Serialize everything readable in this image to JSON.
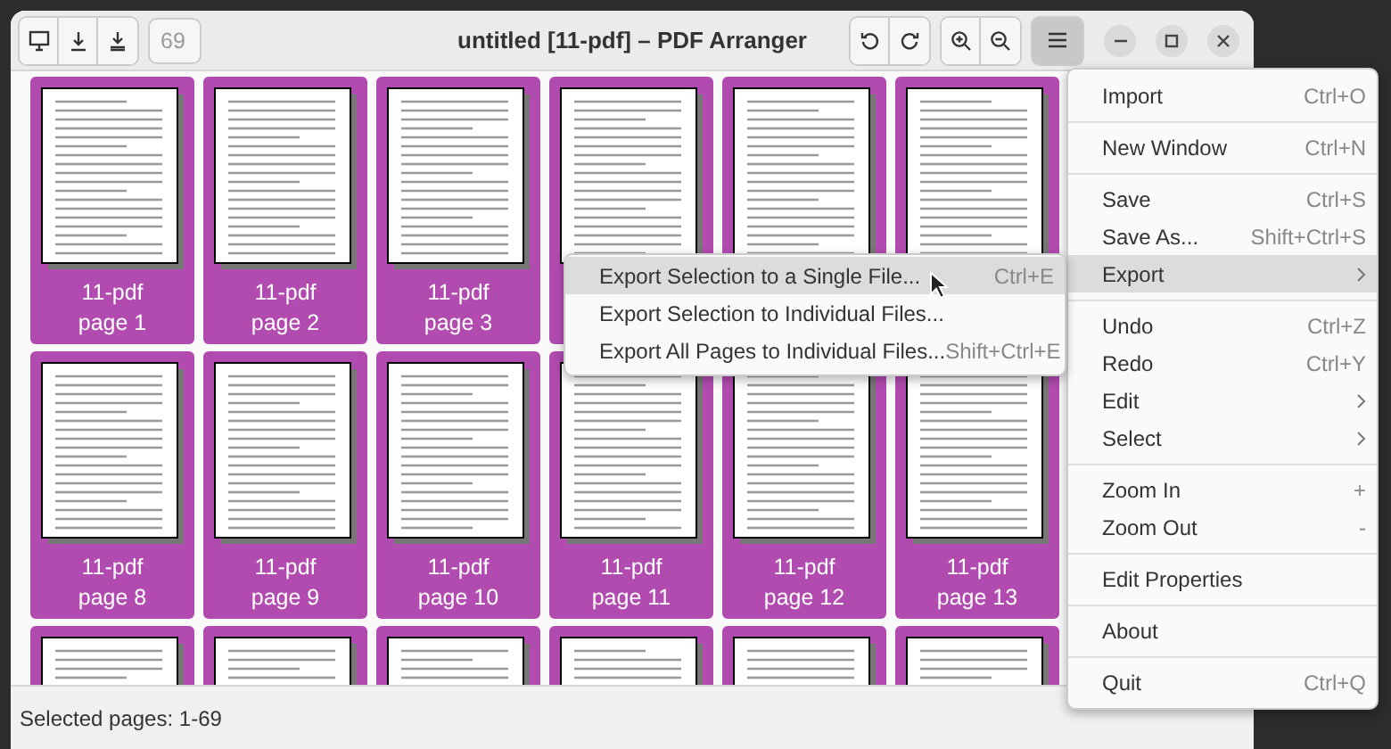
{
  "window": {
    "title": "untitled [11-pdf] – PDF Arranger"
  },
  "page_field": {
    "value": "69"
  },
  "menu_button": {
    "pressed": true
  },
  "pages": [
    {
      "file": "11-pdf",
      "page": "page 1",
      "selected": true
    },
    {
      "file": "11-pdf",
      "page": "page 2",
      "selected": true
    },
    {
      "file": "11-pdf",
      "page": "page 3",
      "selected": true
    },
    {
      "selected": true
    },
    {
      "selected": true
    },
    {
      "selected": true
    },
    {
      "file": "11-pdf",
      "page": "page 8",
      "selected": true
    },
    {
      "file": "11-pdf",
      "page": "page 9",
      "selected": true
    },
    {
      "file": "11-pdf",
      "page": "page 10",
      "selected": true
    },
    {
      "file": "11-pdf",
      "page": "page 11",
      "selected": true
    },
    {
      "file": "11-pdf",
      "page": "page 12",
      "selected": true
    },
    {
      "file": "11-pdf",
      "page": "page 13",
      "selected": true
    },
    {
      "selected": true
    },
    {
      "selected": true
    },
    {
      "selected": true
    },
    {
      "selected": true
    },
    {
      "selected": true
    },
    {
      "selected": true
    }
  ],
  "menu": {
    "sections": [
      [
        {
          "kind": "item",
          "label": "Import",
          "shortcut": "Ctrl+O",
          "highlighted": false
        }
      ],
      [
        {
          "kind": "item",
          "label": "New Window",
          "shortcut": "Ctrl+N",
          "highlighted": false
        }
      ],
      [
        {
          "kind": "item",
          "label": "Save",
          "shortcut": "Ctrl+S",
          "highlighted": false
        },
        {
          "kind": "item",
          "label": "Save As...",
          "shortcut": "Shift+Ctrl+S",
          "highlighted": false
        },
        {
          "kind": "submenu",
          "label": "Export",
          "highlighted": true
        }
      ],
      [
        {
          "kind": "item",
          "label": "Undo",
          "shortcut": "Ctrl+Z",
          "highlighted": false
        },
        {
          "kind": "item",
          "label": "Redo",
          "shortcut": "Ctrl+Y",
          "highlighted": false
        },
        {
          "kind": "submenu",
          "label": "Edit",
          "highlighted": false
        },
        {
          "kind": "submenu",
          "label": "Select",
          "highlighted": false
        }
      ],
      [
        {
          "kind": "item",
          "label": "Zoom In",
          "shortcut": "+",
          "highlighted": false
        },
        {
          "kind": "item",
          "label": "Zoom Out",
          "shortcut": "-",
          "highlighted": false
        }
      ],
      [
        {
          "kind": "item",
          "label": "Edit Properties",
          "highlighted": false
        }
      ],
      [
        {
          "kind": "item",
          "label": "About",
          "highlighted": false
        }
      ],
      [
        {
          "kind": "item",
          "label": "Quit",
          "shortcut": "Ctrl+Q",
          "highlighted": false
        }
      ]
    ]
  },
  "submenu": {
    "items": [
      {
        "label": "Export Selection to a Single File...",
        "shortcut": "Ctrl+E",
        "highlighted": true
      },
      {
        "label": "Export Selection to Individual Files...",
        "highlighted": false
      },
      {
        "label": "Export All Pages to Individual Files...",
        "shortcut": "Shift+Ctrl+E",
        "highlighted": false
      }
    ]
  },
  "status_bar": {
    "text": "Selected pages: 1-69"
  }
}
